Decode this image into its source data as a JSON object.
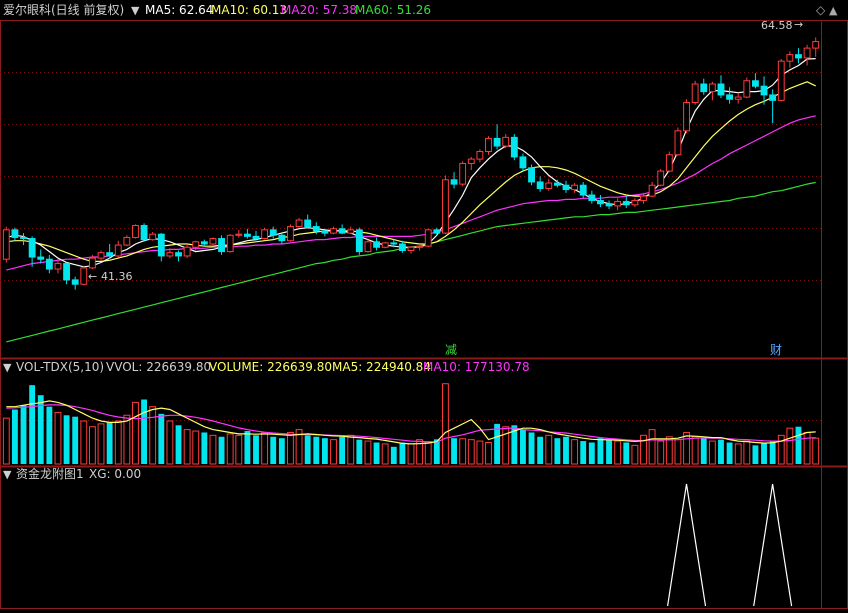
{
  "colors": {
    "background": "#000000",
    "frame": "#8b1a1a",
    "grid": "#7a1010",
    "up": "#ff3b3b",
    "down": "#00e5ee",
    "ma5": "#ffffff",
    "ma10": "#ffff66",
    "ma20": "#ff33ff",
    "ma60": "#33dd33",
    "label": "#cfcfcf",
    "tag_jian": "#33dd33",
    "tag_cai": "#55aaff"
  },
  "header": {
    "stock": "爱尔眼科(日线 前复权)",
    "ma5": "MA5: 62.64",
    "ma10": "MA10: 60.13",
    "ma20": "MA20: 57.38",
    "ma60": "MA60: 51.26"
  },
  "volume_header": {
    "indicator": "VOL-TDX(5,10)",
    "vvol": "VVOL: 226639.80",
    "volume": "VOLUME: 226639.80",
    "ma5": "MA5: 224940.84",
    "ma10": "MA10: 177130.78"
  },
  "signal_header": {
    "indicator": "资金龙附图1",
    "xg": "XG: 0.00"
  },
  "annotations": {
    "max_label": "64.58",
    "min_label": "41.36",
    "event_jian": "减",
    "event_cai": "财"
  },
  "chart_data": {
    "type": "candlestick",
    "price_range": [
      36.5,
      66.0
    ],
    "high_marker": 64.58,
    "low_marker": 41.36,
    "candles": [
      [
        44.2,
        47.2,
        43.9,
        46.9
      ],
      [
        46.9,
        47.1,
        45.9,
        46.2
      ],
      [
        46.2,
        46.6,
        45.5,
        46.1
      ],
      [
        46.1,
        46.3,
        43.5,
        44.4
      ],
      [
        44.4,
        45.1,
        43.8,
        44.2
      ],
      [
        44.2,
        44.6,
        42.9,
        43.3
      ],
      [
        43.3,
        44.2,
        42.9,
        43.8
      ],
      [
        43.8,
        43.9,
        41.9,
        42.3
      ],
      [
        42.3,
        42.6,
        41.4,
        41.9
      ],
      [
        41.9,
        43.6,
        41.8,
        43.4
      ],
      [
        43.4,
        44.6,
        43.3,
        44.3
      ],
      [
        44.3,
        45.0,
        44.1,
        44.8
      ],
      [
        44.8,
        45.6,
        44.2,
        44.5
      ],
      [
        44.5,
        45.9,
        44.4,
        45.5
      ],
      [
        45.5,
        46.4,
        45.4,
        46.2
      ],
      [
        46.2,
        47.4,
        46.1,
        47.3
      ],
      [
        47.3,
        47.5,
        45.8,
        46.0
      ],
      [
        46.0,
        46.7,
        45.9,
        46.5
      ],
      [
        46.5,
        46.6,
        44.0,
        44.5
      ],
      [
        44.5,
        45.2,
        44.3,
        44.8
      ],
      [
        44.8,
        45.0,
        44.0,
        44.5
      ],
      [
        44.5,
        45.6,
        44.3,
        45.3
      ],
      [
        45.3,
        45.9,
        45.0,
        45.8
      ],
      [
        45.8,
        46.0,
        45.4,
        45.6
      ],
      [
        45.6,
        46.2,
        45.5,
        46.1
      ],
      [
        46.1,
        46.4,
        44.6,
        44.9
      ],
      [
        44.9,
        46.5,
        44.8,
        46.4
      ],
      [
        46.4,
        46.9,
        46.2,
        46.5
      ],
      [
        46.5,
        47.0,
        46.1,
        46.3
      ],
      [
        46.3,
        46.8,
        45.9,
        46.1
      ],
      [
        46.1,
        47.1,
        46.0,
        46.9
      ],
      [
        46.9,
        47.2,
        46.1,
        46.4
      ],
      [
        46.4,
        46.6,
        45.6,
        45.9
      ],
      [
        45.9,
        47.4,
        45.8,
        47.2
      ],
      [
        47.2,
        48.0,
        47.1,
        47.8
      ],
      [
        47.8,
        48.3,
        47.0,
        47.2
      ],
      [
        47.2,
        47.6,
        46.5,
        46.8
      ],
      [
        46.8,
        47.0,
        46.3,
        46.6
      ],
      [
        46.6,
        47.2,
        46.5,
        47.0
      ],
      [
        47.0,
        47.4,
        46.5,
        46.6
      ],
      [
        46.6,
        47.2,
        46.5,
        46.9
      ],
      [
        46.9,
        47.1,
        44.6,
        44.9
      ],
      [
        44.9,
        46.0,
        44.8,
        45.8
      ],
      [
        45.8,
        46.2,
        45.0,
        45.3
      ],
      [
        45.3,
        45.8,
        45.2,
        45.7
      ],
      [
        45.7,
        46.0,
        45.3,
        45.6
      ],
      [
        45.6,
        45.9,
        44.8,
        45.0
      ],
      [
        45.0,
        45.4,
        44.7,
        45.3
      ],
      [
        45.3,
        45.6,
        45.0,
        45.4
      ],
      [
        45.4,
        47.0,
        45.3,
        46.9
      ],
      [
        46.9,
        47.1,
        46.4,
        46.6
      ],
      [
        46.6,
        51.9,
        46.5,
        51.5
      ],
      [
        51.5,
        52.2,
        50.7,
        51.1
      ],
      [
        51.1,
        53.2,
        50.9,
        53.0
      ],
      [
        53.0,
        53.6,
        52.4,
        53.4
      ],
      [
        53.4,
        54.3,
        53.1,
        54.1
      ],
      [
        54.1,
        55.5,
        53.8,
        55.3
      ],
      [
        55.3,
        56.6,
        54.3,
        54.6
      ],
      [
        54.6,
        55.7,
        54.4,
        55.4
      ],
      [
        55.4,
        55.7,
        53.3,
        53.6
      ],
      [
        53.6,
        53.9,
        52.3,
        52.6
      ],
      [
        52.6,
        52.9,
        51.0,
        51.3
      ],
      [
        51.3,
        51.8,
        50.4,
        50.7
      ],
      [
        50.7,
        51.6,
        50.5,
        51.2
      ],
      [
        51.2,
        51.5,
        50.8,
        51.0
      ],
      [
        51.0,
        51.4,
        50.3,
        50.6
      ],
      [
        50.6,
        51.2,
        50.3,
        51.0
      ],
      [
        51.0,
        51.3,
        49.8,
        50.1
      ],
      [
        50.1,
        50.5,
        49.3,
        49.6
      ],
      [
        49.6,
        50.1,
        49.0,
        49.3
      ],
      [
        49.3,
        49.6,
        48.8,
        49.1
      ],
      [
        49.1,
        49.8,
        48.7,
        49.5
      ],
      [
        49.5,
        50.1,
        48.9,
        49.2
      ],
      [
        49.2,
        49.8,
        49.0,
        49.6
      ],
      [
        49.6,
        50.3,
        49.3,
        50.0
      ],
      [
        50.0,
        51.3,
        49.9,
        51.0
      ],
      [
        51.0,
        52.5,
        50.9,
        52.3
      ],
      [
        52.3,
        54.1,
        52.2,
        53.8
      ],
      [
        53.8,
        56.3,
        53.7,
        56.0
      ],
      [
        56.0,
        58.9,
        55.8,
        58.6
      ],
      [
        58.6,
        60.6,
        58.4,
        60.3
      ],
      [
        60.3,
        60.8,
        59.3,
        59.6
      ],
      [
        59.6,
        60.5,
        58.8,
        60.3
      ],
      [
        60.3,
        61.1,
        59.0,
        59.3
      ],
      [
        59.3,
        60.0,
        58.5,
        58.9
      ],
      [
        58.9,
        59.5,
        58.5,
        59.1
      ],
      [
        59.1,
        60.9,
        59.0,
        60.6
      ],
      [
        60.6,
        61.3,
        59.9,
        60.1
      ],
      [
        60.1,
        61.0,
        58.4,
        59.3
      ],
      [
        59.3,
        59.8,
        56.7,
        58.8
      ],
      [
        58.8,
        62.6,
        58.7,
        62.4
      ],
      [
        62.4,
        63.3,
        61.8,
        63.0
      ],
      [
        63.0,
        63.6,
        62.2,
        62.7
      ],
      [
        62.7,
        63.9,
        62.0,
        63.6
      ],
      [
        63.6,
        64.58,
        62.8,
        64.2
      ]
    ],
    "ma5_series": [
      46.2,
      46.4,
      46.3,
      45.9,
      45.5,
      44.9,
      44.3,
      43.9,
      43.7,
      43.5,
      43.6,
      43.9,
      44.3,
      44.8,
      45.1,
      45.6,
      45.9,
      46.1,
      46.0,
      45.8,
      45.5,
      45.2,
      44.9,
      45.0,
      45.1,
      45.3,
      45.5,
      45.7,
      45.9,
      46.0,
      46.2,
      46.4,
      46.6,
      46.8,
      47.0,
      47.1,
      47.0,
      46.9,
      46.8,
      46.8,
      46.6,
      46.3,
      46.0,
      45.7,
      45.5,
      45.4,
      45.3,
      45.3,
      45.3,
      45.6,
      46.4,
      47.6,
      48.8,
      50.1,
      51.7,
      52.6,
      53.4,
      54.1,
      54.6,
      54.6,
      54.2,
      53.6,
      52.7,
      51.9,
      51.3,
      50.9,
      50.6,
      50.2,
      49.8,
      49.5,
      49.3,
      49.2,
      49.3,
      49.5,
      49.8,
      50.4,
      51.2,
      52.4,
      54.1,
      56.1,
      57.8,
      58.9,
      59.7,
      59.7,
      59.6,
      59.5,
      59.6,
      59.6,
      59.7,
      60.2,
      61.1,
      61.6,
      62.0,
      62.6,
      62.64
    ],
    "ma10_series": [
      45.8,
      45.9,
      45.9,
      45.8,
      45.6,
      45.4,
      45.1,
      44.8,
      44.5,
      44.2,
      44.0,
      44.0,
      44.1,
      44.3,
      44.5,
      44.8,
      45.1,
      45.3,
      45.4,
      45.5,
      45.6,
      45.6,
      45.5,
      45.4,
      45.4,
      45.5,
      45.5,
      45.6,
      45.7,
      45.8,
      45.9,
      46.0,
      46.2,
      46.3,
      46.5,
      46.6,
      46.7,
      46.8,
      46.8,
      46.8,
      46.8,
      46.7,
      46.6,
      46.4,
      46.2,
      46.0,
      45.8,
      45.7,
      45.6,
      45.6,
      45.8,
      46.3,
      46.9,
      47.6,
      48.4,
      49.2,
      49.9,
      50.6,
      51.3,
      51.9,
      52.3,
      52.6,
      52.7,
      52.7,
      52.6,
      52.4,
      52.1,
      51.7,
      51.3,
      50.9,
      50.6,
      50.3,
      50.1,
      50.0,
      50.0,
      50.1,
      50.4,
      50.9,
      51.6,
      52.6,
      53.6,
      54.6,
      55.5,
      56.2,
      56.9,
      57.5,
      58.0,
      58.4,
      58.7,
      59.1,
      59.5,
      59.9,
      60.2,
      60.5,
      60.13
    ],
    "ma20_series": [
      43.2,
      43.4,
      43.6,
      43.8,
      43.9,
      44.0,
      44.1,
      44.2,
      44.2,
      44.3,
      44.4,
      44.4,
      44.5,
      44.6,
      44.7,
      44.8,
      44.9,
      45.0,
      45.0,
      45.1,
      45.1,
      45.2,
      45.2,
      45.2,
      45.3,
      45.3,
      45.3,
      45.4,
      45.4,
      45.5,
      45.5,
      45.6,
      45.6,
      45.7,
      45.8,
      45.9,
      46.0,
      46.0,
      46.1,
      46.2,
      46.2,
      46.3,
      46.3,
      46.3,
      46.3,
      46.3,
      46.3,
      46.3,
      46.4,
      46.5,
      46.7,
      46.9,
      47.2,
      47.5,
      47.8,
      48.1,
      48.4,
      48.7,
      48.9,
      49.1,
      49.3,
      49.4,
      49.5,
      49.6,
      49.6,
      49.7,
      49.7,
      49.8,
      49.8,
      49.8,
      49.9,
      49.9,
      50.0,
      50.1,
      50.2,
      50.4,
      50.6,
      50.9,
      51.2,
      51.6,
      52.0,
      52.5,
      53.0,
      53.4,
      53.9,
      54.3,
      54.7,
      55.1,
      55.5,
      55.9,
      56.3,
      56.7,
      57.0,
      57.2,
      57.38
    ],
    "ma60_series": [
      36.6,
      36.8,
      37.0,
      37.2,
      37.4,
      37.6,
      37.8,
      38.0,
      38.2,
      38.4,
      38.6,
      38.8,
      39.0,
      39.2,
      39.4,
      39.6,
      39.8,
      40.0,
      40.2,
      40.4,
      40.6,
      40.8,
      41.0,
      41.2,
      41.4,
      41.6,
      41.8,
      42.0,
      42.2,
      42.4,
      42.6,
      42.8,
      43.0,
      43.2,
      43.4,
      43.6,
      43.8,
      43.9,
      44.1,
      44.2,
      44.4,
      44.5,
      44.6,
      44.8,
      44.9,
      45.0,
      45.2,
      45.3,
      45.4,
      45.6,
      45.8,
      46.0,
      46.2,
      46.4,
      46.6,
      46.8,
      47.0,
      47.2,
      47.3,
      47.4,
      47.5,
      47.6,
      47.7,
      47.8,
      47.9,
      48.0,
      48.1,
      48.1,
      48.2,
      48.3,
      48.3,
      48.4,
      48.5,
      48.5,
      48.6,
      48.7,
      48.8,
      48.9,
      49.0,
      49.1,
      49.2,
      49.3,
      49.4,
      49.5,
      49.6,
      49.8,
      49.9,
      50.0,
      50.2,
      50.4,
      50.5,
      50.7,
      50.9,
      51.1,
      51.26
    ],
    "volume_range": [
      0,
      300000
    ],
    "volumes": [
      160000,
      190000,
      205000,
      275000,
      240000,
      200000,
      180000,
      170000,
      165000,
      150000,
      130000,
      140000,
      145000,
      150000,
      170000,
      215000,
      225000,
      200000,
      175000,
      150000,
      135000,
      120000,
      115000,
      110000,
      100000,
      95000,
      105000,
      100000,
      115000,
      100000,
      110000,
      95000,
      90000,
      110000,
      120000,
      100000,
      95000,
      90000,
      85000,
      95000,
      100000,
      85000,
      80000,
      75000,
      70000,
      60000,
      75000,
      70000,
      85000,
      78000,
      86000,
      280000,
      90000,
      88000,
      85000,
      80000,
      75000,
      140000,
      130000,
      135000,
      120000,
      110000,
      95000,
      100000,
      90000,
      95000,
      85000,
      80000,
      75000,
      90000,
      85000,
      80000,
      75000,
      65000,
      100000,
      120000,
      80000,
      95000,
      85000,
      110000,
      95000,
      90000,
      80000,
      85000,
      75000,
      70000,
      80000,
      65000,
      75000,
      80000,
      100000,
      125000,
      130000,
      110000,
      90000
    ],
    "vol_ma5_series": [
      200000,
      200000,
      205000,
      210000,
      214000,
      220000,
      215000,
      205000,
      190000,
      175000,
      160000,
      150000,
      145000,
      145000,
      150000,
      165000,
      180000,
      190000,
      195000,
      190000,
      175000,
      160000,
      145000,
      130000,
      120000,
      115000,
      110000,
      105000,
      105000,
      104000,
      105000,
      104000,
      102000,
      100000,
      103000,
      105000,
      103000,
      100000,
      98000,
      97000,
      94000,
      92000,
      89000,
      87000,
      82000,
      77000,
      72000,
      70000,
      71000,
      73000,
      78000,
      110000,
      125000,
      140000,
      155000,
      125000,
      85000,
      95000,
      105000,
      115000,
      125000,
      125000,
      120000,
      112000,
      105000,
      100000,
      95000,
      90000,
      86000,
      85000,
      84000,
      83000,
      81000,
      79000,
      81000,
      88000,
      88000,
      88000,
      90000,
      98000,
      97000,
      95000,
      92000,
      92000,
      85000,
      80000,
      78000,
      75000,
      73000,
      74000,
      80000,
      90000,
      100000,
      110000,
      112000
    ],
    "vol_ma10_series": [
      195000,
      196000,
      198000,
      200000,
      204000,
      206000,
      206000,
      204000,
      200000,
      194000,
      187000,
      178000,
      170000,
      164000,
      160000,
      158000,
      160000,
      163000,
      167000,
      170000,
      170000,
      167000,
      163000,
      157000,
      150000,
      142000,
      134000,
      126000,
      120000,
      115000,
      111000,
      108000,
      106000,
      104000,
      103000,
      103000,
      102000,
      101000,
      100000,
      99000,
      99000,
      97000,
      95000,
      92000,
      89000,
      86000,
      83000,
      80000,
      79000,
      77000,
      76000,
      90000,
      96000,
      102000,
      110000,
      118000,
      120000,
      122000,
      124000,
      126000,
      120000,
      118000,
      116000,
      112000,
      110000,
      108000,
      104000,
      100000,
      96000,
      92000,
      89000,
      87000,
      84000,
      82000,
      82000,
      84000,
      84000,
      84000,
      85000,
      88000,
      90000,
      91000,
      90000,
      90000,
      88000,
      86000,
      85000,
      83000,
      81000,
      80000,
      80000,
      82000,
      86000,
      90000,
      92000
    ],
    "xg_range": [
      0,
      1
    ],
    "xg_signals": [
      {
        "index": 79,
        "value": 1
      },
      {
        "index": 89,
        "value": 1
      }
    ]
  }
}
